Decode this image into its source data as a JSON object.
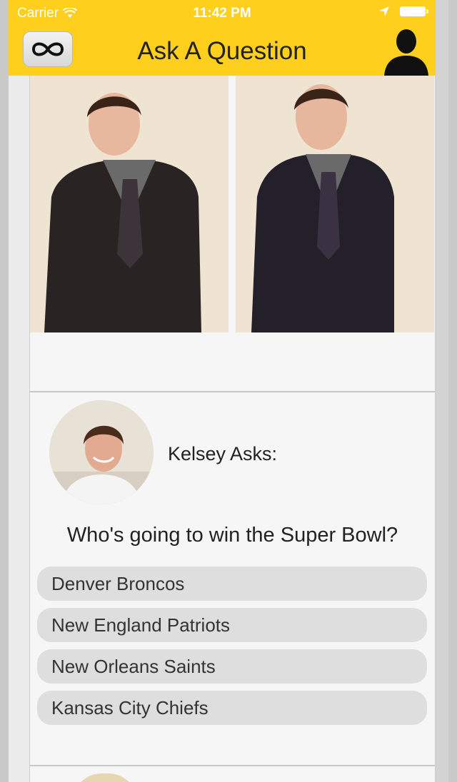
{
  "status_bar": {
    "carrier": "Carrier",
    "time": "11:42 PM"
  },
  "nav": {
    "title": "Ask A Question",
    "left_icon": "infinity-icon",
    "right_icon": "profile-icon"
  },
  "question": {
    "asker_label": "Kelsey Asks:",
    "text": "Who's going to win the Super Bowl?",
    "answers": [
      "Denver Broncos",
      "New England Patriots",
      "New Orleans Saints",
      "Kansas City Chiefs"
    ]
  },
  "colors": {
    "nav_bar": "#fecf1c",
    "answer_bg": "#dedede"
  }
}
